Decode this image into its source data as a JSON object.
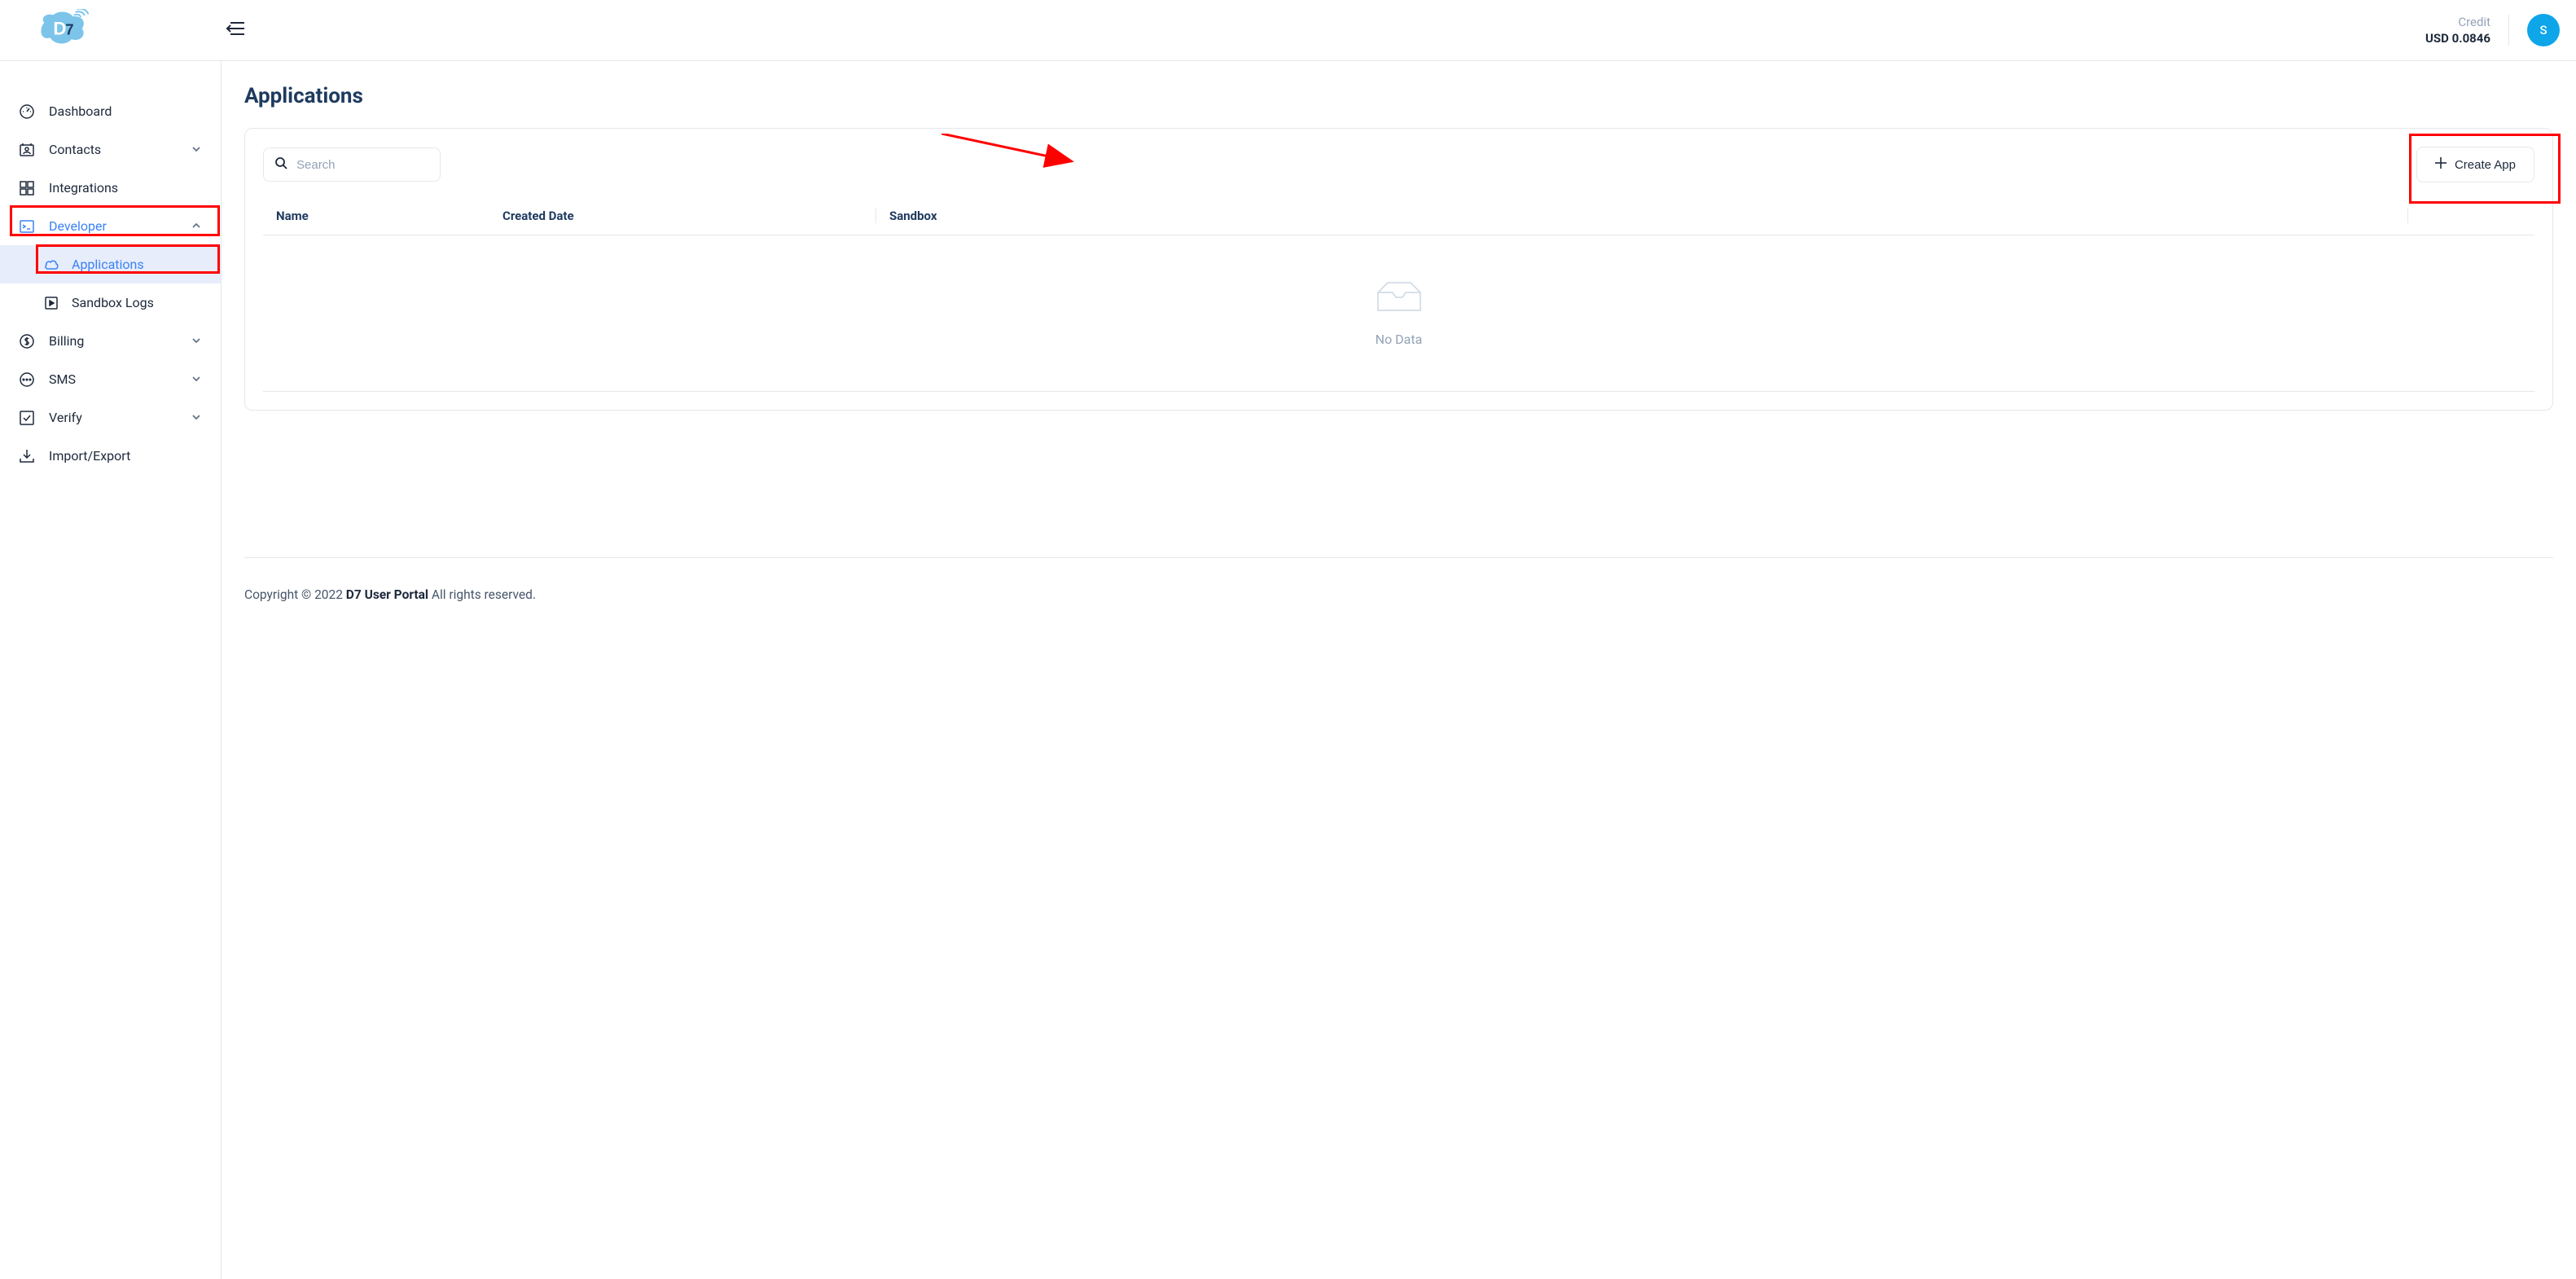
{
  "header": {
    "credit_label": "Credit",
    "credit_value": "USD 0.0846",
    "avatar_initial": "S"
  },
  "sidebar": {
    "items": [
      {
        "label": "Dashboard"
      },
      {
        "label": "Contacts"
      },
      {
        "label": "Integrations"
      },
      {
        "label": "Developer"
      },
      {
        "label": "Billing"
      },
      {
        "label": "SMS"
      },
      {
        "label": "Verify"
      },
      {
        "label": "Import/Export"
      }
    ],
    "developer_sub": [
      {
        "label": "Applications"
      },
      {
        "label": "Sandbox Logs"
      }
    ]
  },
  "page": {
    "title": "Applications",
    "search_placeholder": "Search",
    "create_btn": "Create App",
    "columns": {
      "name": "Name",
      "created_date": "Created Date",
      "sandbox": "Sandbox"
    },
    "empty": "No Data"
  },
  "footer": {
    "prefix": "Copyright © 2022 ",
    "brand": "D7 User Portal",
    "suffix": " All rights reserved."
  }
}
